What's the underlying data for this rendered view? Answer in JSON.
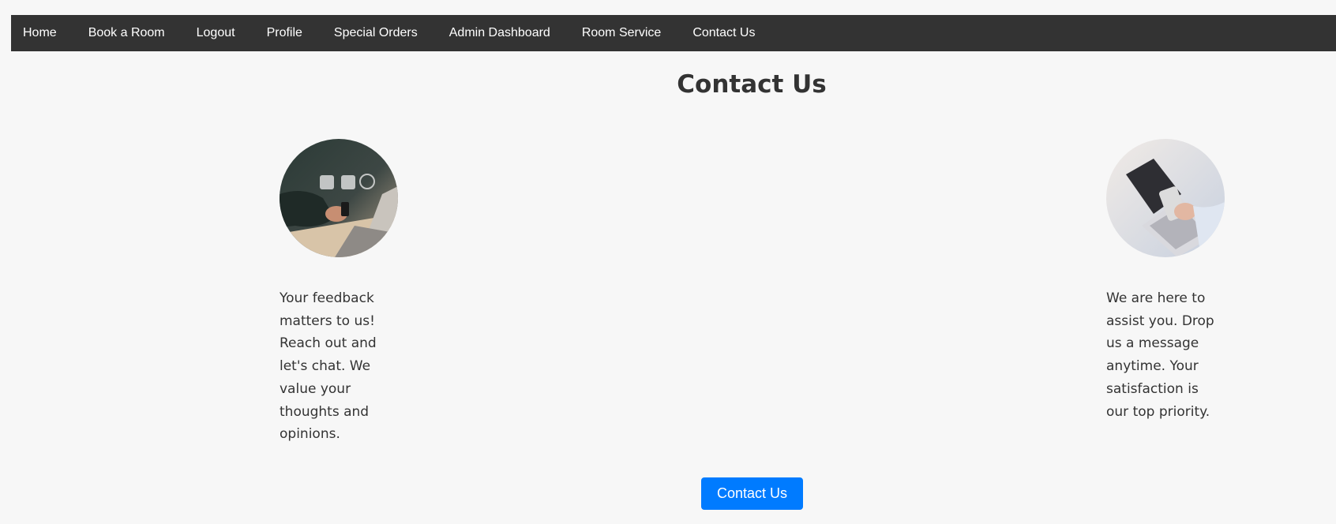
{
  "nav": {
    "items": [
      {
        "label": "Home"
      },
      {
        "label": "Book a Room"
      },
      {
        "label": "Logout"
      },
      {
        "label": "Profile"
      },
      {
        "label": "Special Orders"
      },
      {
        "label": "Admin Dashboard"
      },
      {
        "label": "Room Service"
      },
      {
        "label": "Contact Us"
      }
    ],
    "background": "#333333",
    "text_color": "#ffffff"
  },
  "main": {
    "title": "Contact Us",
    "left_text": "Your feedback matters to us! Reach out and let's chat. We value your thoughts and opinions.",
    "right_text": "We are here to assist you. Drop us a message anytime. Your satisfaction is our top priority.",
    "button_label": "Contact Us",
    "button_color": "#007bff"
  }
}
